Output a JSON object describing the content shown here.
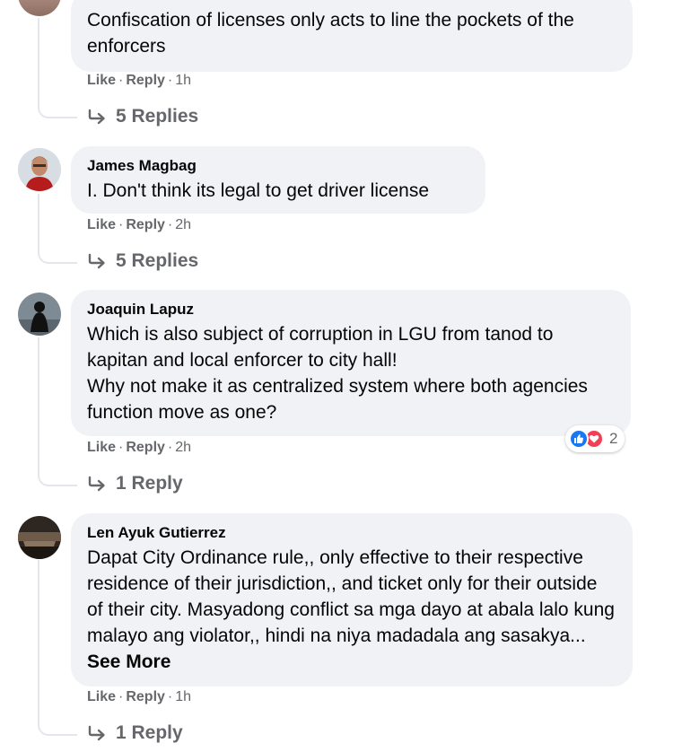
{
  "comments": [
    {
      "author": "",
      "text": "Confiscation of licenses only acts to line the pockets of the enforcers",
      "like_label": "Like",
      "reply_label": "Reply",
      "time": "1h",
      "replies_label": "5 Replies"
    },
    {
      "author": "James Magbag",
      "text": "I. Don't think its legal to get driver license",
      "like_label": "Like",
      "reply_label": "Reply",
      "time": "2h",
      "replies_label": "5 Replies"
    },
    {
      "author": "Joaquin Lapuz",
      "text": "Which is also subject of corruption in LGU from tanod to kapitan and local enforcer to city hall!\nWhy not make it as centralized system where both agencies function move as one?",
      "like_label": "Like",
      "reply_label": "Reply",
      "time": "2h",
      "replies_label": "1 Reply",
      "reactions": {
        "icons": [
          "like-icon",
          "love-icon"
        ],
        "count": "2",
        "colors": {
          "like": "#1877f2",
          "love": "#f33e58"
        }
      }
    },
    {
      "author": "Len Ayuk Gutierrez",
      "text": "Dapat City Ordinance rule,, only effective to their respective residence of their jurisdiction,, and ticket only for their outside of their city. Masyadong conflict sa mga dayo at abala lalo kung malayo ang violator,, hindi na niya madadala ang sasakya...",
      "see_more": "See More",
      "like_label": "Like",
      "reply_label": "Reply",
      "time": "1h",
      "replies_label": "1 Reply"
    }
  ],
  "separator": "·",
  "colors": {
    "bubble": "#f0f2f5",
    "secondary_text": "#65676b",
    "thread_line": "#e4e6eb"
  }
}
